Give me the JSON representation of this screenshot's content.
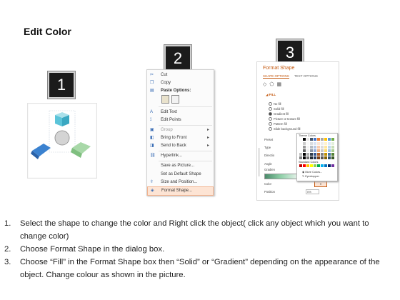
{
  "title": "Edit Color",
  "badges": [
    "1",
    "2",
    "3"
  ],
  "context_menu": {
    "items": [
      {
        "label": "Cut",
        "icon": "scissors-icon",
        "glyph": "✂"
      },
      {
        "label": "Copy",
        "icon": "copy-icon",
        "glyph": "❐"
      },
      {
        "label": "Paste Options:",
        "icon": "paste-icon",
        "glyph": "▤",
        "bold": true
      },
      {
        "label": "Edit Text",
        "icon": "edit-text-icon",
        "glyph": "A"
      },
      {
        "label": "Edit Points",
        "icon": "edit-points-icon",
        "glyph": "⟟"
      },
      {
        "label": "Group",
        "icon": "group-icon",
        "glyph": "▣",
        "submenu": true,
        "disabled": true
      },
      {
        "label": "Bring to Front",
        "icon": "bring-to-front-icon",
        "glyph": "◧",
        "submenu": true
      },
      {
        "label": "Send to Back",
        "icon": "send-to-back-icon",
        "glyph": "◨",
        "submenu": true
      },
      {
        "label": "Hyperlink...",
        "icon": "hyperlink-icon",
        "glyph": "⛓"
      },
      {
        "label": "Save as Picture...",
        "icon": "",
        "glyph": ""
      },
      {
        "label": "Set as Default Shape",
        "icon": "",
        "glyph": ""
      },
      {
        "label": "Size and Position...",
        "icon": "size-position-icon",
        "glyph": "⇳"
      },
      {
        "label": "Format Shape...",
        "icon": "format-shape-icon",
        "glyph": "◈",
        "highlighted": true
      }
    ]
  },
  "format_panel": {
    "title": "Format Shape",
    "tabs": [
      "SHAPE OPTIONS",
      "TEXT OPTIONS"
    ],
    "fill_header": "FILL",
    "fill_options": [
      "No fill",
      "Solid fill",
      "Gradient fill",
      "Picture or texture fill",
      "Pattern fill",
      "Slide background fill"
    ],
    "selected_fill": "Gradient fill",
    "side_labels": [
      "Preset",
      "Type",
      "Directio",
      "Angle",
      "Gradien",
      "Color",
      "Position"
    ],
    "palette": {
      "theme_label": "Theme Colors",
      "standard_label": "Standard Colors",
      "more_colors": "More Colors...",
      "eyedropper": "Eyedropper",
      "theme_colors": [
        "#ffffff",
        "#000000",
        "#e7e6e6",
        "#44546a",
        "#4472c4",
        "#ed7d31",
        "#a5a5a5",
        "#ffc000",
        "#5b9bd5",
        "#70ad47"
      ],
      "standard_colors": [
        "#c00000",
        "#ff0000",
        "#ffc000",
        "#ffff00",
        "#92d050",
        "#00b050",
        "#00b0f0",
        "#0070c0",
        "#002060",
        "#7030a0"
      ]
    },
    "position_value": "0%"
  },
  "shape_colors": {
    "top": "#5bc4d9",
    "left": "#3b82d0",
    "right": "#8fc98f",
    "center": "#bdbdbd"
  },
  "steps": [
    {
      "num": "1.",
      "text": "Select the shape to change the color and Right click the object( click any object which you want to change color)"
    },
    {
      "num": "2.",
      "text": "Choose Format Shape in the dialog box."
    },
    {
      "num": "3.",
      "text": "Choose “Fill” in the Format Shape box then “Solid” or “Gradient” depending on the appearance of the object. Change colour as shown in the picture."
    }
  ]
}
